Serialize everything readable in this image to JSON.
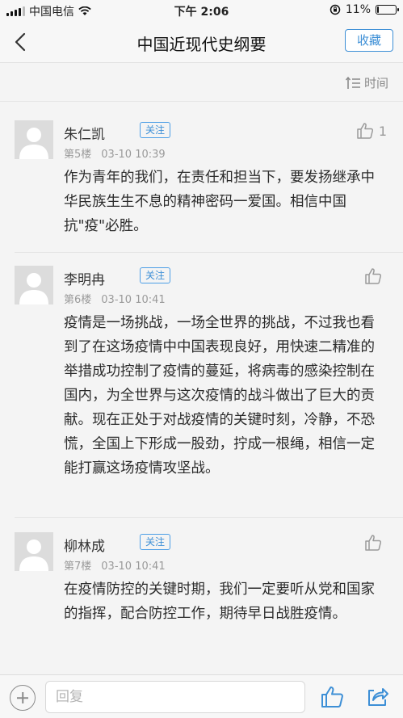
{
  "status": {
    "carrier": "中国电信",
    "time": "下午 2:06",
    "battery": "11%",
    "battery_level": 0.11
  },
  "nav": {
    "title": "中国近现代史纲要",
    "favorite_label": "收藏"
  },
  "sort": {
    "label": "时间"
  },
  "comments": [
    {
      "name": "朱仁凯",
      "follow": "关注",
      "floor": "第5楼",
      "datetime": "03-10 10:39",
      "likes": "1",
      "text": "作为青年的我们，在责任和担当下，要发扬继承中华民族生生不息的精神密码一爱国。相信中国抗\"疫\"必胜。"
    },
    {
      "name": "李明冉",
      "follow": "关注",
      "floor": "第6楼",
      "datetime": "03-10 10:41",
      "likes": "",
      "text": "疫情是一场挑战，一场全世界的挑战，不过我也看到了在这场疫情中中国表现良好，用快速二精准的举措成功控制了疫情的蔓延，将病毒的感染控制在国内，为全世界与这次疫情的战斗做出了巨大的贡献。现在正处于对战疫情的关键时刻，冷静，不恐慌，全国上下形成一股劲，拧成一根绳，相信一定能打赢这场疫情攻坚战。"
    },
    {
      "name": "柳林成",
      "follow": "关注",
      "floor": "第7楼",
      "datetime": "03-10 10:41",
      "likes": "",
      "text": "在疫情防控的关键时期，我们一定要听从党和国家的指挥，配合防控工作，期待早日战胜疫情。"
    }
  ],
  "bottom": {
    "reply_placeholder": "回复"
  },
  "colors": {
    "accent": "#3d8fd6",
    "muted": "#9a9a9a"
  }
}
